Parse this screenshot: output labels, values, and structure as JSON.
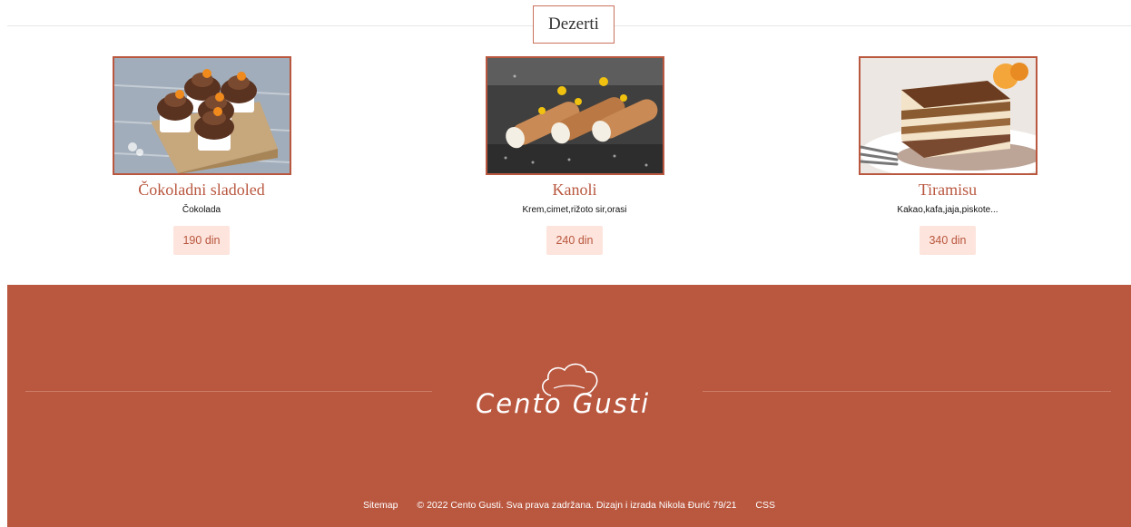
{
  "section": {
    "title": "Dezerti"
  },
  "products": [
    {
      "name": "Čokoladni sladoled",
      "description": "Čokolada",
      "price": "190 din",
      "image": "chocolate-cupcakes-photo"
    },
    {
      "name": "Kanoli",
      "description": "Krem,cimet,rižoto sir,orasi",
      "price": "240 din",
      "image": "cannoli-photo"
    },
    {
      "name": "Tiramisu",
      "description": "Kakao,kafa,jaja,piskote...",
      "price": "340 din",
      "image": "tiramisu-photo"
    }
  ],
  "footer": {
    "logo_text": "Cento Gusti",
    "sitemap_label": "Sitemap",
    "copyright": "© 2022 Cento Gusti. Sva prava zadržana. Dizajn i izrada Nikola Đurić 79/21",
    "css_label": "CSS"
  },
  "colors": {
    "accent": "#b9573f",
    "price_bg": "#fde4dc",
    "footer_bg": "#b9573f"
  }
}
